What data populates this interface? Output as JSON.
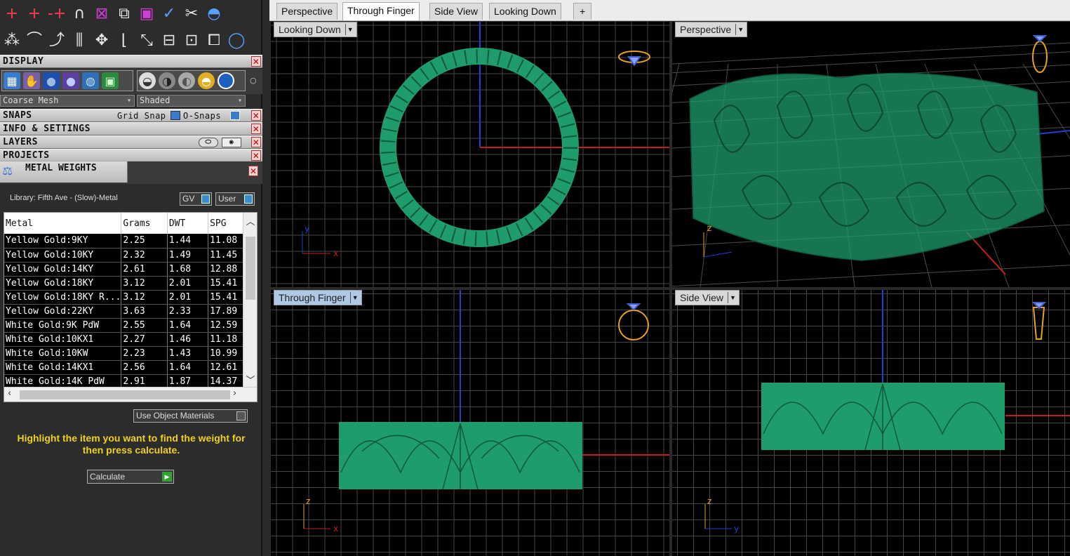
{
  "toolbar": {
    "row1": [
      "+",
      "+",
      "-+",
      "∩",
      "⊠",
      "⧉",
      "▣",
      "✓",
      "✂",
      "◓"
    ],
    "row2": [
      "⁂",
      "⌒",
      "⤴",
      "⫼",
      "✥",
      "⌊",
      "⤡",
      "⊟",
      "⊡",
      "⧠",
      "◯"
    ]
  },
  "panels": {
    "display": "DISPLAY",
    "snaps": "SNAPS",
    "grid_snap": "Grid Snap",
    "osnaps": "O-Snaps",
    "info": "INFO & SETTINGS",
    "layers": "LAYERS",
    "projects": "PROJECTS",
    "metal": "METAL WEIGHTS"
  },
  "display": {
    "mesh": "Coarse Mesh",
    "shade": "Shaded"
  },
  "metal": {
    "library": "Library: Fifth Ave - (Slow)-Metal",
    "gv": "GV",
    "user": "User",
    "columns": [
      "Metal",
      "Grams",
      "DWT",
      "SPG"
    ],
    "rows": [
      [
        "Yellow Gold:9KY",
        "2.25",
        "1.44",
        "11.08"
      ],
      [
        "Yellow Gold:10KY",
        "2.32",
        "1.49",
        "11.45"
      ],
      [
        "Yellow Gold:14KY",
        "2.61",
        "1.68",
        "12.88"
      ],
      [
        "Yellow Gold:18KY",
        "3.12",
        "2.01",
        "15.41"
      ],
      [
        "Yellow Gold:18KY R...",
        "3.12",
        "2.01",
        "15.41"
      ],
      [
        "Yellow Gold:22KY",
        "3.63",
        "2.33",
        "17.89"
      ],
      [
        "White Gold:9K PdW",
        "2.55",
        "1.64",
        "12.59"
      ],
      [
        "White Gold:10KX1",
        "2.27",
        "1.46",
        "11.18"
      ],
      [
        "White Gold:10KW",
        "2.23",
        "1.43",
        "10.99"
      ],
      [
        "White Gold:14KX1",
        "2.56",
        "1.64",
        "12.61"
      ],
      [
        "White Gold:14K PdW",
        "2.91",
        "1.87",
        "14.37"
      ]
    ],
    "use_object": "Use Object Materials",
    "hint": "Highlight the item you want to find the weight for then press calculate.",
    "calculate": "Calculate"
  },
  "tabs": [
    "Perspective",
    "Through Finger",
    "Side View",
    "Looking Down",
    "+"
  ],
  "active_tab": "Through Finger",
  "viewports": {
    "top_left": "Looking Down",
    "top_right": "Perspective",
    "bottom_left": "Through Finger",
    "bottom_right": "Side View"
  },
  "axes": {
    "x": "x",
    "y": "y",
    "z": "z"
  },
  "colors": {
    "model": "#1f9c6c",
    "grid": "#4a4a4a",
    "xaxis": "#c02020",
    "yaxis": "#2040c0",
    "gizmo": "#e8a020"
  }
}
